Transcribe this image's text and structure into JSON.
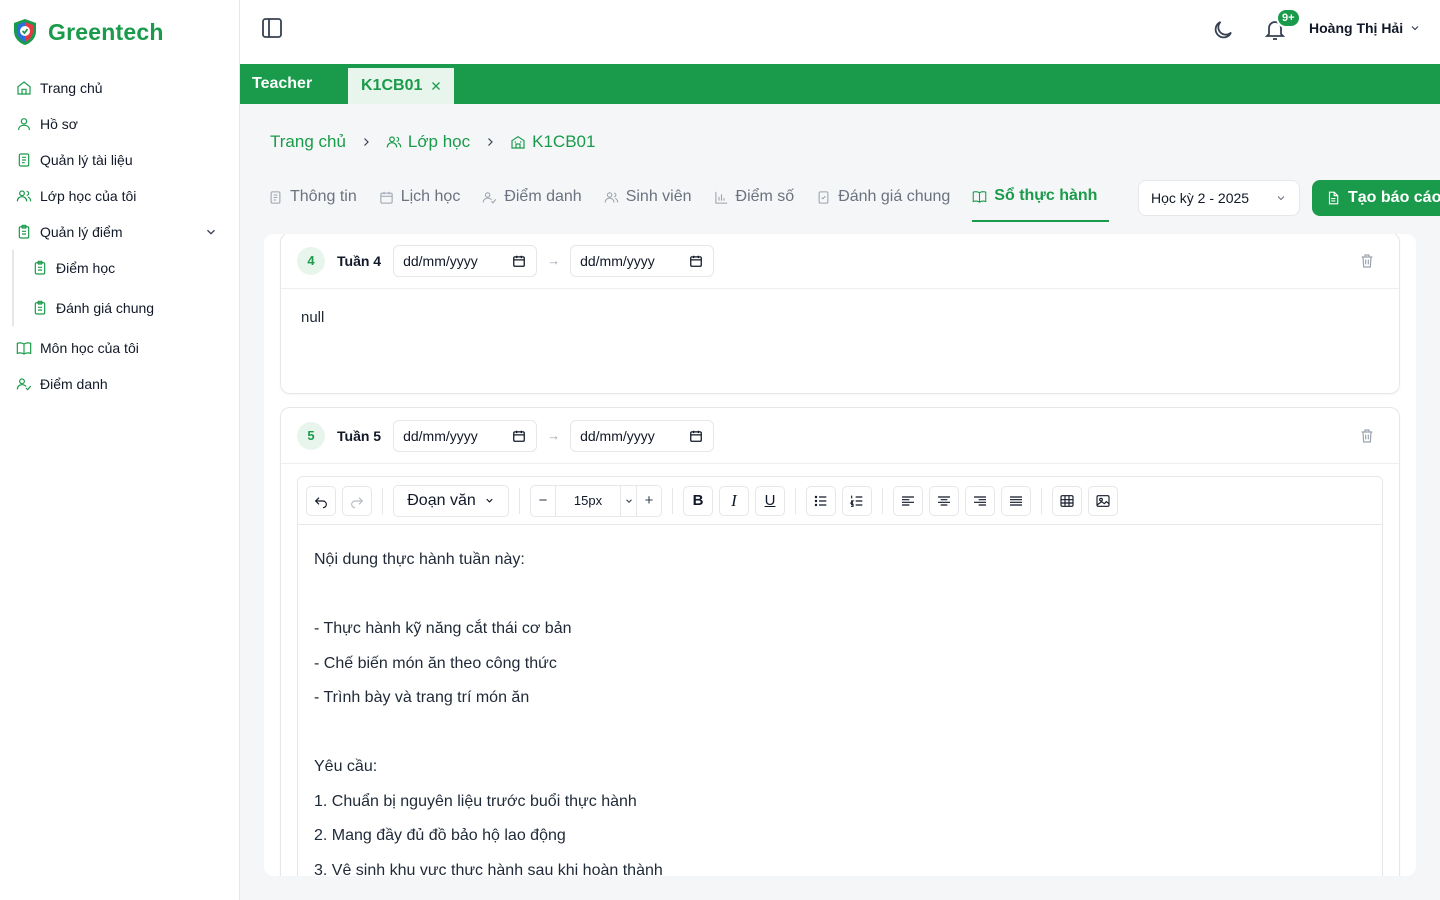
{
  "brand": {
    "name": "Greentech",
    "color": "#1a9b4b"
  },
  "sidebar": {
    "items": [
      {
        "label": "Trang chủ",
        "icon": "home-icon"
      },
      {
        "label": "Hồ sơ",
        "icon": "user-icon"
      },
      {
        "label": "Quản lý tài liệu",
        "icon": "document-icon"
      },
      {
        "label": "Lớp học của tôi",
        "icon": "users-icon"
      },
      {
        "label": "Quản lý điểm",
        "icon": "clipboard-icon",
        "expanded": true
      },
      {
        "label": "Điểm học",
        "icon": "clipboard-icon",
        "sub": true
      },
      {
        "label": "Đánh giá chung",
        "icon": "clipboard-icon",
        "sub": true
      },
      {
        "label": "Môn học của tôi",
        "icon": "book-icon"
      },
      {
        "label": "Điểm danh",
        "icon": "user-check-icon"
      }
    ]
  },
  "topbar": {
    "notification_count": "9+",
    "user_name": "Hoàng Thị Hải"
  },
  "tabstrip": {
    "role": "Teacher",
    "open_tab": "K1CB01"
  },
  "breadcrumb": {
    "items": [
      "Trang chủ",
      "Lớp học",
      "K1CB01"
    ]
  },
  "subtabs": {
    "items": [
      "Thông tin",
      "Lịch học",
      "Điểm danh",
      "Sinh viên",
      "Điểm số",
      "Đánh giá chung",
      "Sổ thực hành"
    ],
    "active": "Sổ thực hành"
  },
  "semester": {
    "selected": "Học kỳ 2 - 2025"
  },
  "report_button": {
    "label": "Tạo báo cáo"
  },
  "weeks": [
    {
      "number": "4",
      "label": "Tuần 4",
      "start_date": "dd/mm/yyyy",
      "end_date": "dd/mm/yyyy",
      "content": "null"
    },
    {
      "number": "5",
      "label": "Tuần 5",
      "start_date": "dd/mm/yyyy",
      "end_date": "dd/mm/yyyy",
      "editor": {
        "block_type": "Đoạn văn",
        "font_size": "15px",
        "lines": [
          "Nội dung thực hành tuần này:",
          "",
          "- Thực hành kỹ năng cắt thái cơ bản",
          "- Chế biến món ăn theo công thức",
          "- Trình bày và trang trí món ăn",
          "",
          "Yêu cầu:",
          "1. Chuẩn bị nguyên liệu trước buổi thực hành",
          "2. Mang đầy đủ đồ bảo hộ lao động",
          "3. Vệ sinh khu vực thực hành sau khi hoàn thành"
        ]
      }
    }
  ]
}
